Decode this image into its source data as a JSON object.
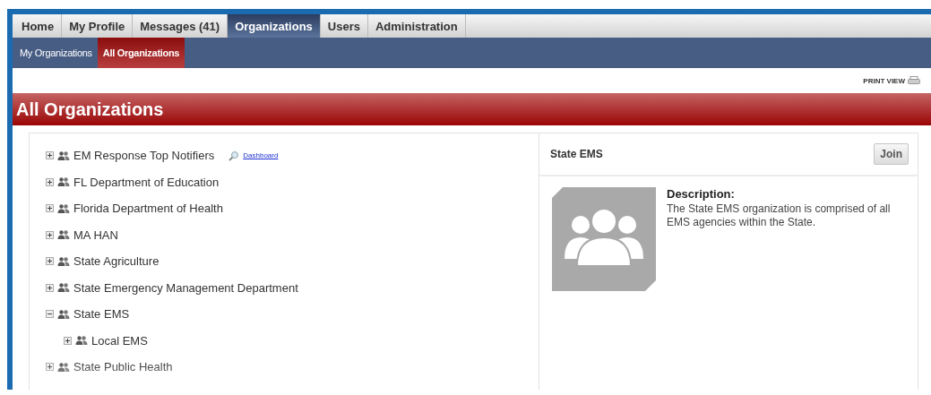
{
  "tabs": [
    {
      "label": "Home",
      "selected": false
    },
    {
      "label": "My Profile",
      "selected": false
    },
    {
      "label": "Messages (41)",
      "selected": false
    },
    {
      "label": "Organizations",
      "selected": true
    },
    {
      "label": "Users",
      "selected": false
    },
    {
      "label": "Administration",
      "selected": false
    }
  ],
  "subtabs": [
    {
      "label": "My Organizations",
      "selected": false
    },
    {
      "label": "All Organizations",
      "selected": true
    }
  ],
  "print_view": "PRINT VIEW",
  "page_title": "All Organizations",
  "tree": [
    {
      "name": "EM Response Top Notifiers",
      "expanded": false,
      "link": "Dashboard"
    },
    {
      "name": "FL Department of Education",
      "expanded": false
    },
    {
      "name": "Florida Department of Health",
      "expanded": false
    },
    {
      "name": "MA HAN",
      "expanded": false
    },
    {
      "name": "State Agriculture",
      "expanded": false
    },
    {
      "name": "State Emergency Management Department",
      "expanded": false
    },
    {
      "name": "State EMS",
      "expanded": true,
      "children": [
        {
          "name": "Local EMS",
          "expanded": false
        }
      ]
    },
    {
      "name": "State Public Health",
      "expanded": false
    }
  ],
  "detail": {
    "title": "State EMS",
    "button": "Join",
    "description_label": "Description:",
    "description": "The State EMS organization is comprised of all EMS agencies within the State."
  }
}
